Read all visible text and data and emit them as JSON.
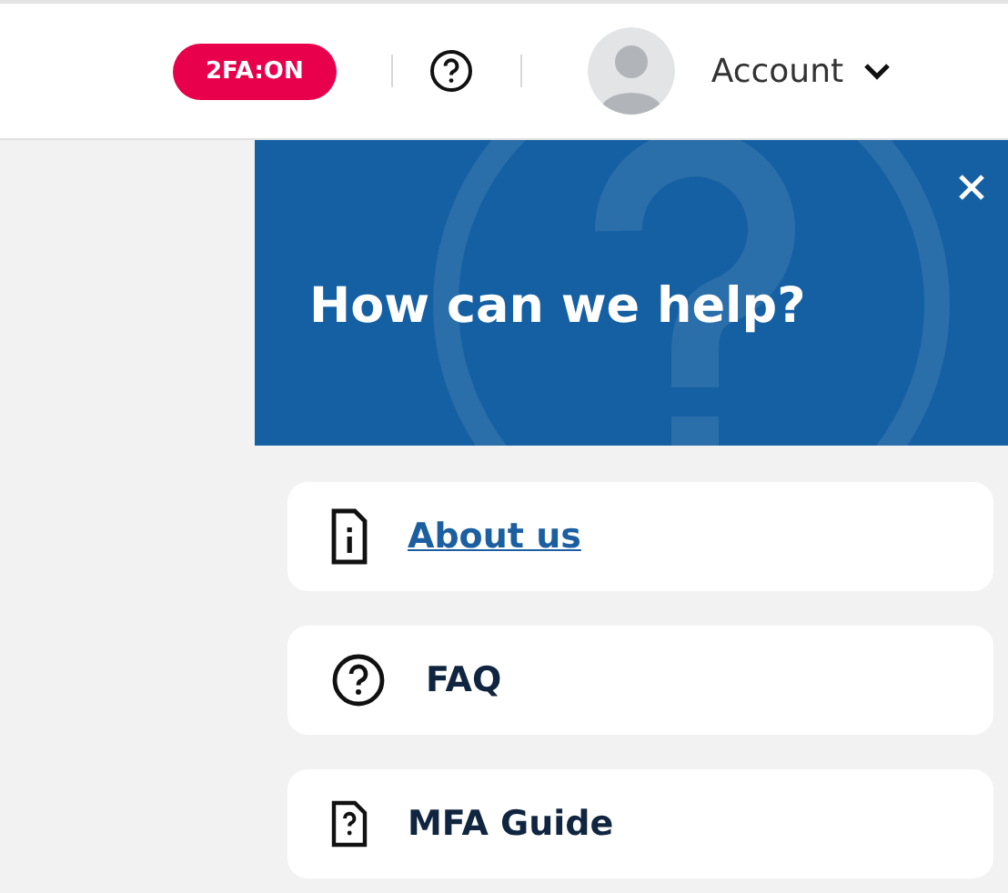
{
  "header": {
    "badge": "2FA:ON",
    "account": {
      "label": "Account"
    }
  },
  "help_panel": {
    "title": "How can we help?",
    "items": [
      {
        "label": "About us",
        "kind": "info-document",
        "focused": true
      },
      {
        "label": "FAQ",
        "kind": "question-circle",
        "focused": false
      },
      {
        "label": "MFA Guide",
        "kind": "question-document",
        "focused": false
      }
    ]
  }
}
